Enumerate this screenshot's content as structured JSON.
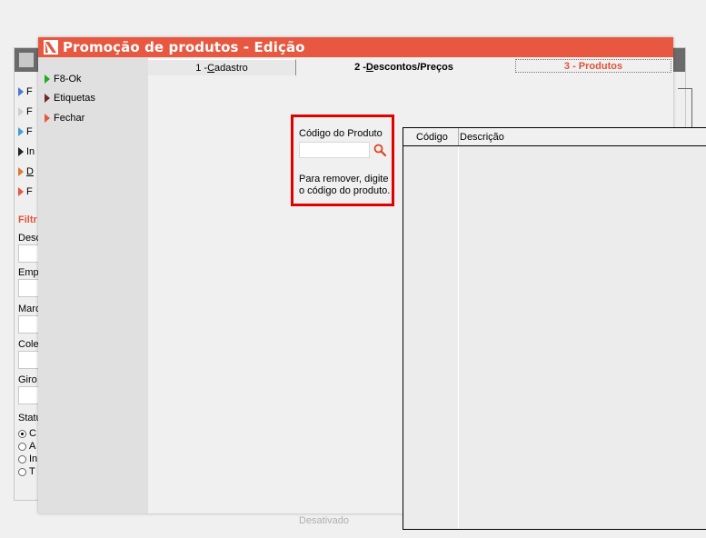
{
  "dialog": {
    "title": "Promoção de produtos - Edição",
    "accent": "#e8573f"
  },
  "sidebar": {
    "items": [
      {
        "label": "F8-Ok",
        "color": "#1faa1f"
      },
      {
        "label": "Etiquetas",
        "color": "#6b2a2a"
      },
      {
        "label": "Fechar",
        "color": "#e8573f"
      }
    ]
  },
  "tabs": {
    "tab1": {
      "prefix": "1 - ",
      "underline": "C",
      "rest": "adastro"
    },
    "tab2": {
      "prefix": "2 - ",
      "underline": "D",
      "rest": "escontos/Preços"
    },
    "tab3": {
      "label": "3 - Produtos"
    }
  },
  "product": {
    "code_label": "Código do Produto",
    "code_value": "",
    "help_text": "Para remover, digite o código do produto."
  },
  "grid": {
    "columns": [
      "Código",
      "Descrição"
    ]
  },
  "status": {
    "disabled_label": "Desativado"
  },
  "background": {
    "items": [
      "F",
      "F",
      "F",
      "In",
      "D",
      "F"
    ],
    "item_colors": [
      "#4a7ad8",
      "#cfcfcf",
      "#4a9ad8",
      "#222222",
      "#e07a30",
      "#e8573f"
    ],
    "filter_title": "Filtr",
    "fields": [
      "Desc",
      "Emp",
      "Marc",
      "Cole",
      "Giro"
    ],
    "status_label": "Statu",
    "radios": [
      "C",
      "A",
      "In",
      "T"
    ]
  }
}
